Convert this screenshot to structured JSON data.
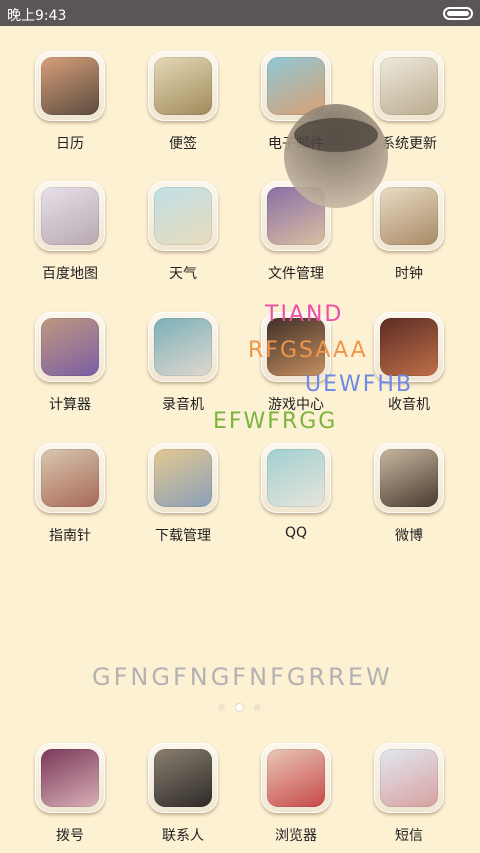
{
  "status_bar": {
    "time": "晚上9:43"
  },
  "apps_grid": [
    {
      "label": "日历",
      "icon": "calendar-icon",
      "c1": "#d8a07a",
      "c2": "#5b4a3e"
    },
    {
      "label": "便签",
      "icon": "notes-icon",
      "c1": "#e5d9b8",
      "c2": "#a08a5a"
    },
    {
      "label": "电子邮件",
      "icon": "email-icon",
      "c1": "#8fc8d8",
      "c2": "#d9a070"
    },
    {
      "label": "系统更新",
      "icon": "system-update-icon",
      "c1": "#efe9dc",
      "c2": "#b9ab8f"
    },
    {
      "label": "百度地图",
      "icon": "map-icon",
      "c1": "#e8e0e8",
      "c2": "#b6a8b2"
    },
    {
      "label": "天气",
      "icon": "weather-icon",
      "c1": "#bfe0e6",
      "c2": "#e8dcbc"
    },
    {
      "label": "文件管理",
      "icon": "file-manager-icon",
      "c1": "#8a6ea8",
      "c2": "#d9c0a0"
    },
    {
      "label": "时钟",
      "icon": "clock-icon",
      "c1": "#e9dcc4",
      "c2": "#a88a66"
    },
    {
      "label": "计算器",
      "icon": "calculator-icon",
      "c1": "#c09880",
      "c2": "#7b5ea6"
    },
    {
      "label": "录音机",
      "icon": "recorder-icon",
      "c1": "#7ab0b8",
      "c2": "#e0d8cf"
    },
    {
      "label": "游戏中心",
      "icon": "game-center-icon",
      "c1": "#3e3028",
      "c2": "#c79060"
    },
    {
      "label": "收音机",
      "icon": "radio-icon",
      "c1": "#5b2c24",
      "c2": "#c07048"
    },
    {
      "label": "指南针",
      "icon": "compass-icon",
      "c1": "#d8c8b0",
      "c2": "#a86858"
    },
    {
      "label": "下载管理",
      "icon": "download-icon",
      "c1": "#e3c890",
      "c2": "#8aa0b8"
    },
    {
      "label": "QQ",
      "icon": "qq-icon",
      "c1": "#9fd0d0",
      "c2": "#e8e4dc"
    },
    {
      "label": "微博",
      "icon": "weibo-icon",
      "c1": "#c8b8a0",
      "c2": "#4a3a30"
    }
  ],
  "dock": [
    {
      "label": "拨号",
      "icon": "phone-icon",
      "c1": "#7a3858",
      "c2": "#d8b0b8"
    },
    {
      "label": "联系人",
      "icon": "contacts-icon",
      "c1": "#8a8070",
      "c2": "#2e2a28"
    },
    {
      "label": "浏览器",
      "icon": "browser-icon",
      "c1": "#e8c8b8",
      "c2": "#c84848"
    },
    {
      "label": "短信",
      "icon": "sms-icon",
      "c1": "#e0e8f0",
      "c2": "#d8a0a0"
    }
  ],
  "watermarks": [
    "TIAND",
    "RFGSAAA",
    "UEWFHB",
    "EFWFRGG",
    "GFNGFNGFNFGRREW"
  ],
  "pager": {
    "pages": 3,
    "active_index": 1
  }
}
